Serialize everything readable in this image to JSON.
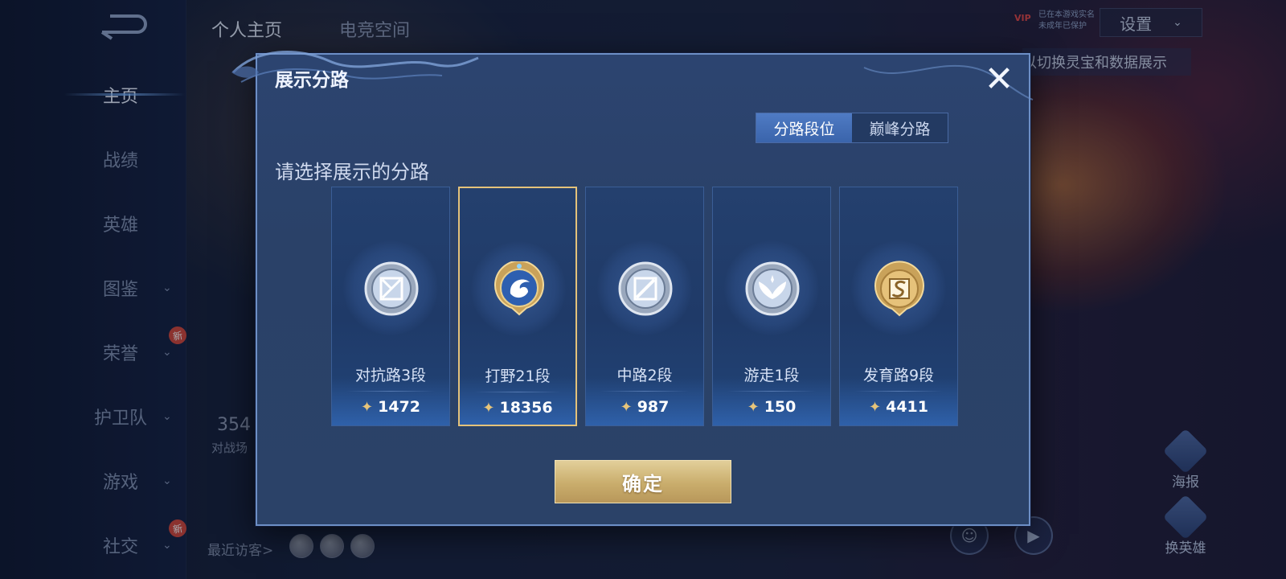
{
  "background": {
    "back_icon": "back-arrow-icon",
    "sidebar": {
      "items": [
        {
          "label": "主页",
          "active": true,
          "chevron": false,
          "new": false
        },
        {
          "label": "战绩",
          "active": false,
          "chevron": false,
          "new": false
        },
        {
          "label": "英雄",
          "active": false,
          "chevron": false,
          "new": false
        },
        {
          "label": "图鉴",
          "active": false,
          "chevron": true,
          "new": false
        },
        {
          "label": "荣誉",
          "active": false,
          "chevron": true,
          "new": true
        },
        {
          "label": "护卫队",
          "active": false,
          "chevron": true,
          "new": false
        },
        {
          "label": "游戏",
          "active": false,
          "chevron": true,
          "new": false
        },
        {
          "label": "社交",
          "active": false,
          "chevron": true,
          "new": true
        }
      ],
      "new_badge": "新"
    },
    "tabs": [
      "个人主页",
      "电竞空间"
    ],
    "vip": {
      "badge": "VIP",
      "line1": "已在本游戏实名",
      "line2": "未成年已保护"
    },
    "settings_label": "设置",
    "switch_hint": "以切换灵宝和数据展示",
    "stat": {
      "value": "354",
      "label": "对战场"
    },
    "recent_visitors_label": "最近访客>",
    "right_buttons": {
      "poster": "海报",
      "swap_hero": "换英雄"
    }
  },
  "modal": {
    "title": "展示分路",
    "close_icon": "close-x-icon",
    "segment": {
      "options": [
        "分路段位",
        "巅峰分路"
      ],
      "selected": 0
    },
    "prompt": "请选择展示的分路",
    "selected_index": 1,
    "lanes": [
      {
        "label": "对抗路3段",
        "score": "1472",
        "icon": "clash-lane-emblem-icon",
        "tier": "silver"
      },
      {
        "label": "打野21段",
        "score": "18356",
        "icon": "jungle-dragon-emblem-icon",
        "tier": "gold"
      },
      {
        "label": "中路2段",
        "score": "987",
        "icon": "mid-lane-emblem-icon",
        "tier": "silver"
      },
      {
        "label": "游走1段",
        "score": "150",
        "icon": "roam-wings-emblem-icon",
        "tier": "silver"
      },
      {
        "label": "发育路9段",
        "score": "4411",
        "icon": "farm-lane-emblem-icon",
        "tier": "gold"
      }
    ],
    "confirm_label": "确定",
    "colors": {
      "accent_blue": "#4f7bc4",
      "gold": "#e4c27a",
      "panel": "#2c4470"
    }
  }
}
